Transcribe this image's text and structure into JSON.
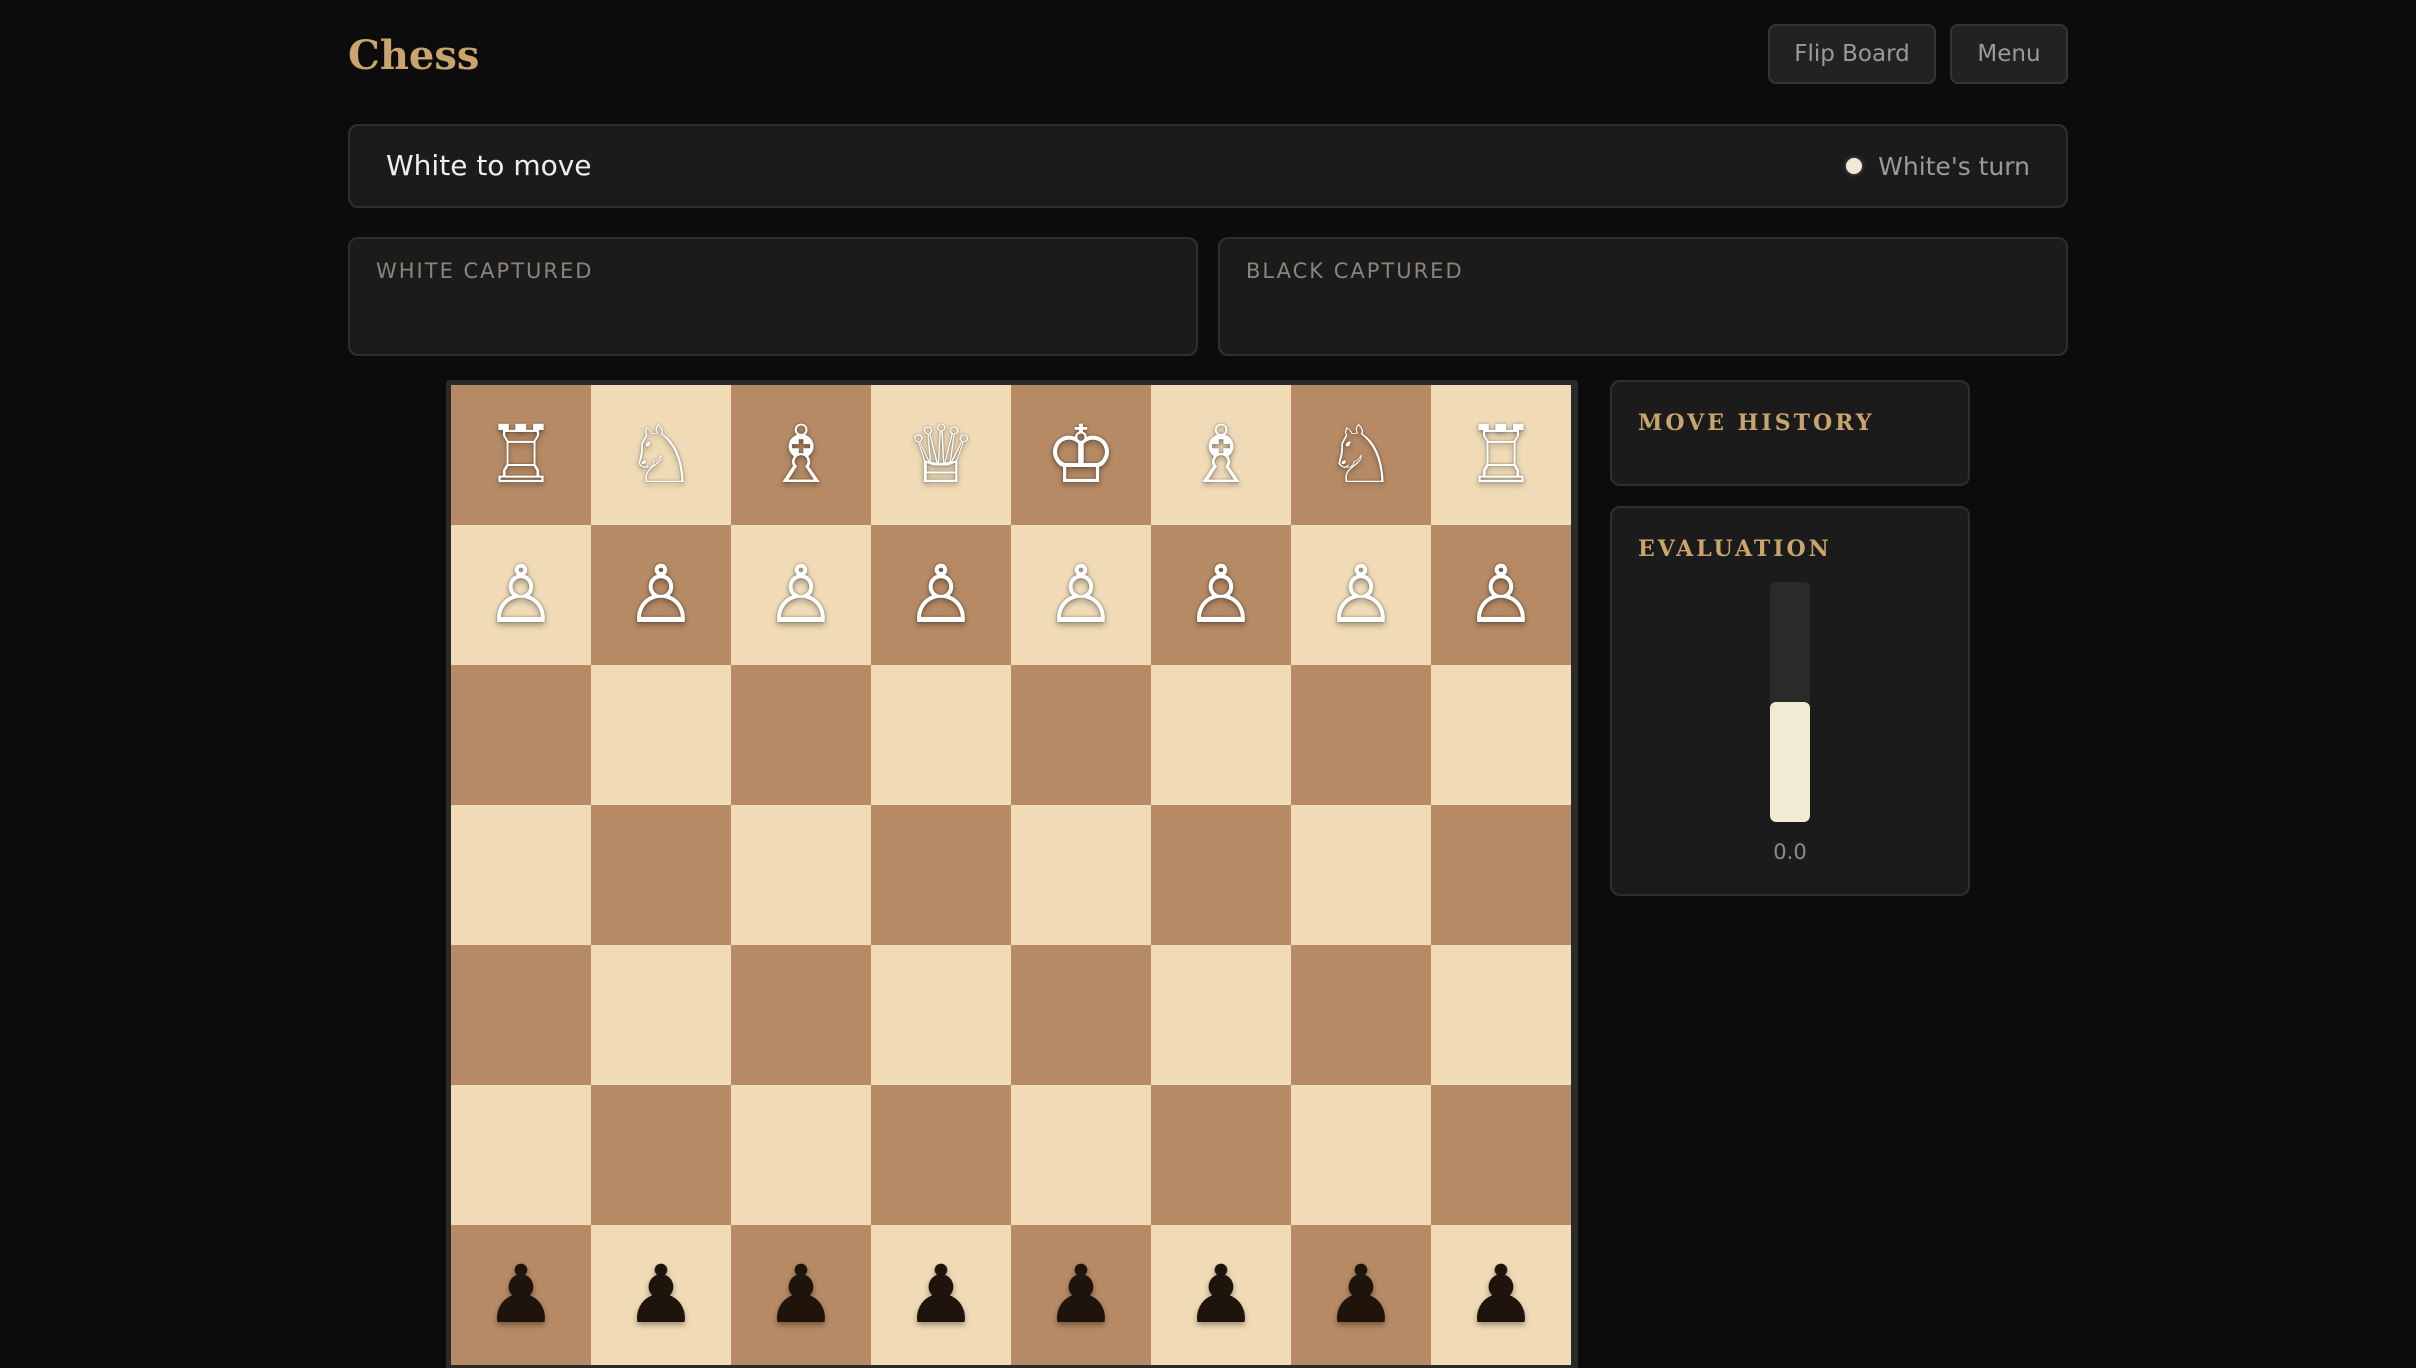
{
  "header": {
    "title": "Chess",
    "flip_label": "Flip Board",
    "menu_label": "Menu"
  },
  "status": {
    "text": "White to move",
    "turn_label": "White's turn"
  },
  "captured": {
    "white_label": "WHITE CAPTURED",
    "black_label": "BLACK CAPTURED"
  },
  "board": {
    "colors": {
      "light": "#f0dbb6",
      "dark": "#b68a65"
    },
    "rows": [
      [
        "♖",
        "♘",
        "♗",
        "♕",
        "♔",
        "♗",
        "♘",
        "♖"
      ],
      [
        "♙",
        "♙",
        "♙",
        "♙",
        "♙",
        "♙",
        "♙",
        "♙"
      ],
      [
        "",
        "",
        "",
        "",
        "",
        "",
        "",
        ""
      ],
      [
        "",
        "",
        "",
        "",
        "",
        "",
        "",
        ""
      ],
      [
        "",
        "",
        "",
        "",
        "",
        "",
        "",
        ""
      ],
      [
        "",
        "",
        "",
        "",
        "",
        "",
        "",
        ""
      ],
      [
        "♟",
        "♟",
        "♟",
        "♟",
        "♟",
        "♟",
        "♟",
        "♟"
      ]
    ]
  },
  "history": {
    "title": "MOVE HISTORY"
  },
  "evaluation": {
    "title": "EVALUATION",
    "value": "0.0",
    "white_fraction": 0.5
  }
}
